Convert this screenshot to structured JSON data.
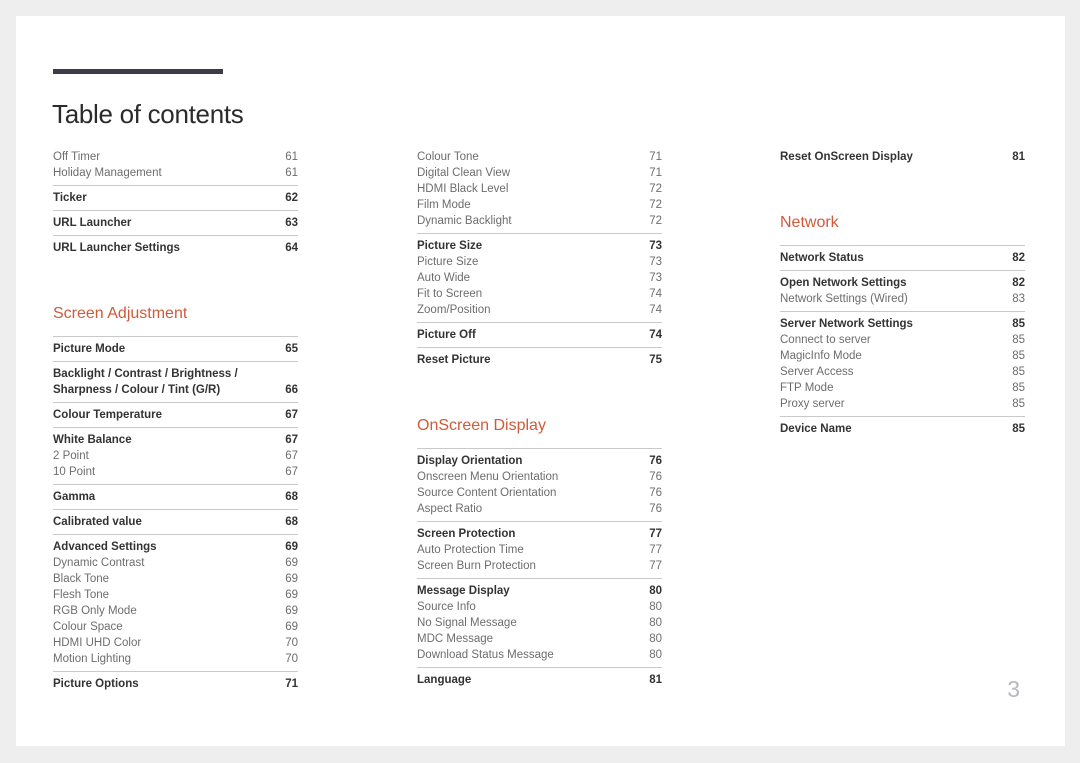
{
  "header": {
    "title": "Table of contents"
  },
  "footer": {
    "page_number": "3"
  },
  "colors": {
    "section_heading": "#d05a3a",
    "rule": "#3b3b4a",
    "level1_text": "#333333",
    "level2_text": "#6d6d6d",
    "separator": "#c9c9c9",
    "page_number": "#b6b8bd",
    "page_bg": "#ffffff",
    "canvas_bg": "#efeeee"
  },
  "columns": [
    {
      "id": "col-0",
      "blocks": [
        {
          "type": "group",
          "rule": false,
          "entries": [
            {
              "label": "Off Timer",
              "page": "61",
              "level": 2
            },
            {
              "label": "Holiday Management",
              "page": "61",
              "level": 2
            }
          ]
        },
        {
          "type": "group",
          "rule": true,
          "entries": [
            {
              "label": "Ticker",
              "page": "62",
              "level": 1
            }
          ]
        },
        {
          "type": "group",
          "rule": true,
          "entries": [
            {
              "label": "URL Launcher",
              "page": "63",
              "level": 1
            }
          ]
        },
        {
          "type": "group",
          "rule": true,
          "entries": [
            {
              "label": "URL Launcher Settings",
              "page": "64",
              "level": 1
            }
          ]
        },
        {
          "type": "heading",
          "label": "Screen Adjustment"
        },
        {
          "type": "group",
          "rule": true,
          "entries": [
            {
              "label": "Picture Mode",
              "page": "65",
              "level": 1
            }
          ]
        },
        {
          "type": "group",
          "rule": true,
          "entries": [
            {
              "label": "Backlight / Contrast / Brightness / Sharpness / Colour / Tint (G/R)",
              "page": "66",
              "level": 1,
              "wrapped": true
            }
          ]
        },
        {
          "type": "group",
          "rule": true,
          "entries": [
            {
              "label": "Colour Temperature",
              "page": "67",
              "level": 1
            }
          ]
        },
        {
          "type": "group",
          "rule": true,
          "entries": [
            {
              "label": "White Balance",
              "page": "67",
              "level": 1
            },
            {
              "label": "2 Point",
              "page": "67",
              "level": 2
            },
            {
              "label": "10 Point",
              "page": "67",
              "level": 2
            }
          ]
        },
        {
          "type": "group",
          "rule": true,
          "entries": [
            {
              "label": "Gamma",
              "page": "68",
              "level": 1
            }
          ]
        },
        {
          "type": "group",
          "rule": true,
          "entries": [
            {
              "label": "Calibrated value",
              "page": "68",
              "level": 1
            }
          ]
        },
        {
          "type": "group",
          "rule": true,
          "entries": [
            {
              "label": "Advanced Settings",
              "page": "69",
              "level": 1
            },
            {
              "label": "Dynamic Contrast",
              "page": "69",
              "level": 2
            },
            {
              "label": "Black Tone",
              "page": "69",
              "level": 2
            },
            {
              "label": "Flesh Tone",
              "page": "69",
              "level": 2
            },
            {
              "label": "RGB Only Mode",
              "page": "69",
              "level": 2
            },
            {
              "label": "Colour Space",
              "page": "69",
              "level": 2
            },
            {
              "label": "HDMI UHD Color",
              "page": "70",
              "level": 2
            },
            {
              "label": "Motion Lighting",
              "page": "70",
              "level": 2
            }
          ]
        },
        {
          "type": "group",
          "rule": true,
          "entries": [
            {
              "label": "Picture Options",
              "page": "71",
              "level": 1
            }
          ]
        }
      ]
    },
    {
      "id": "col-1",
      "blocks": [
        {
          "type": "group",
          "rule": false,
          "entries": [
            {
              "label": "Colour Tone",
              "page": "71",
              "level": 2
            },
            {
              "label": "Digital Clean View",
              "page": "71",
              "level": 2
            },
            {
              "label": "HDMI Black Level",
              "page": "72",
              "level": 2
            },
            {
              "label": "Film Mode",
              "page": "72",
              "level": 2
            },
            {
              "label": "Dynamic Backlight",
              "page": "72",
              "level": 2
            }
          ]
        },
        {
          "type": "group",
          "rule": true,
          "entries": [
            {
              "label": "Picture Size",
              "page": "73",
              "level": 1
            },
            {
              "label": "Picture Size",
              "page": "73",
              "level": 2
            },
            {
              "label": "Auto Wide",
              "page": "73",
              "level": 2
            },
            {
              "label": "Fit to Screen",
              "page": "74",
              "level": 2
            },
            {
              "label": "Zoom/Position",
              "page": "74",
              "level": 2
            }
          ]
        },
        {
          "type": "group",
          "rule": true,
          "entries": [
            {
              "label": "Picture Off",
              "page": "74",
              "level": 1
            }
          ]
        },
        {
          "type": "group",
          "rule": true,
          "entries": [
            {
              "label": "Reset Picture",
              "page": "75",
              "level": 1
            }
          ]
        },
        {
          "type": "heading",
          "label": "OnScreen Display"
        },
        {
          "type": "group",
          "rule": true,
          "entries": [
            {
              "label": "Display Orientation",
              "page": "76",
              "level": 1
            },
            {
              "label": "Onscreen Menu Orientation",
              "page": "76",
              "level": 2
            },
            {
              "label": "Source Content Orientation",
              "page": "76",
              "level": 2
            },
            {
              "label": "Aspect Ratio",
              "page": "76",
              "level": 2
            }
          ]
        },
        {
          "type": "group",
          "rule": true,
          "entries": [
            {
              "label": "Screen Protection",
              "page": "77",
              "level": 1
            },
            {
              "label": "Auto Protection Time",
              "page": "77",
              "level": 2
            },
            {
              "label": "Screen Burn Protection",
              "page": "77",
              "level": 2
            }
          ]
        },
        {
          "type": "group",
          "rule": true,
          "entries": [
            {
              "label": "Message Display",
              "page": "80",
              "level": 1
            },
            {
              "label": "Source Info",
              "page": "80",
              "level": 2
            },
            {
              "label": "No Signal Message",
              "page": "80",
              "level": 2
            },
            {
              "label": "MDC Message",
              "page": "80",
              "level": 2
            },
            {
              "label": "Download Status Message",
              "page": "80",
              "level": 2
            }
          ]
        },
        {
          "type": "group",
          "rule": true,
          "entries": [
            {
              "label": "Language",
              "page": "81",
              "level": 1
            }
          ]
        }
      ]
    },
    {
      "id": "col-2",
      "blocks": [
        {
          "type": "group",
          "rule": false,
          "entries": [
            {
              "label": "Reset OnScreen Display",
              "page": "81",
              "level": 1
            }
          ]
        },
        {
          "type": "heading",
          "label": "Network"
        },
        {
          "type": "group",
          "rule": true,
          "entries": [
            {
              "label": "Network Status",
              "page": "82",
              "level": 1
            }
          ]
        },
        {
          "type": "group",
          "rule": true,
          "entries": [
            {
              "label": "Open Network Settings",
              "page": "82",
              "level": 1
            },
            {
              "label": "Network Settings (Wired)",
              "page": "83",
              "level": 2
            }
          ]
        },
        {
          "type": "group",
          "rule": true,
          "entries": [
            {
              "label": "Server Network Settings",
              "page": "85",
              "level": 1
            },
            {
              "label": "Connect to server",
              "page": "85",
              "level": 2
            },
            {
              "label": "MagicInfo Mode",
              "page": "85",
              "level": 2
            },
            {
              "label": "Server Access",
              "page": "85",
              "level": 2
            },
            {
              "label": "FTP Mode",
              "page": "85",
              "level": 2
            },
            {
              "label": "Proxy server",
              "page": "85",
              "level": 2
            }
          ]
        },
        {
          "type": "group",
          "rule": true,
          "entries": [
            {
              "label": "Device Name",
              "page": "85",
              "level": 1
            }
          ]
        }
      ]
    }
  ]
}
